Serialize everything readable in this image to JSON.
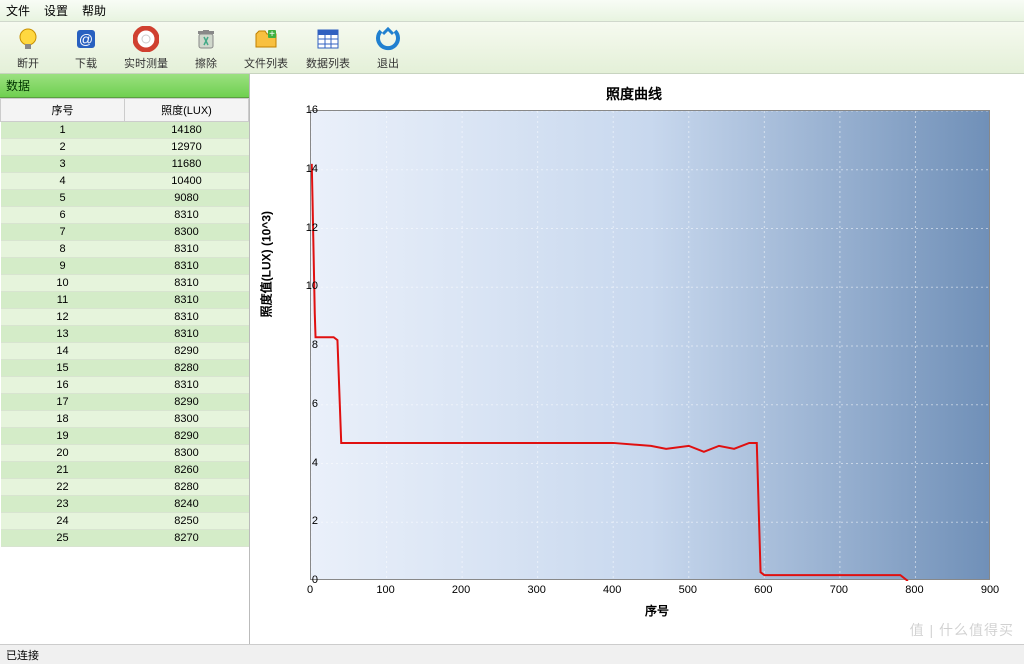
{
  "menubar": {
    "file": "文件",
    "settings": "设置",
    "help": "帮助"
  },
  "toolbar": {
    "disconnect": "断开",
    "download": "下载",
    "realtime": "实时测量",
    "erase": "擦除",
    "filelist": "文件列表",
    "datalist": "数据列表",
    "exit": "退出"
  },
  "panel": {
    "title": "数据"
  },
  "table": {
    "headers": {
      "seq": "序号",
      "lux": "照度(LUX)"
    },
    "rows": [
      {
        "seq": 1,
        "lux": 14180
      },
      {
        "seq": 2,
        "lux": 12970
      },
      {
        "seq": 3,
        "lux": 11680
      },
      {
        "seq": 4,
        "lux": 10400
      },
      {
        "seq": 5,
        "lux": 9080
      },
      {
        "seq": 6,
        "lux": 8310
      },
      {
        "seq": 7,
        "lux": 8300
      },
      {
        "seq": 8,
        "lux": 8310
      },
      {
        "seq": 9,
        "lux": 8310
      },
      {
        "seq": 10,
        "lux": 8310
      },
      {
        "seq": 11,
        "lux": 8310
      },
      {
        "seq": 12,
        "lux": 8310
      },
      {
        "seq": 13,
        "lux": 8310
      },
      {
        "seq": 14,
        "lux": 8290
      },
      {
        "seq": 15,
        "lux": 8280
      },
      {
        "seq": 16,
        "lux": 8310
      },
      {
        "seq": 17,
        "lux": 8290
      },
      {
        "seq": 18,
        "lux": 8300
      },
      {
        "seq": 19,
        "lux": 8290
      },
      {
        "seq": 20,
        "lux": 8300
      },
      {
        "seq": 21,
        "lux": 8260
      },
      {
        "seq": 22,
        "lux": 8280
      },
      {
        "seq": 23,
        "lux": 8240
      },
      {
        "seq": 24,
        "lux": 8250
      },
      {
        "seq": 25,
        "lux": 8270
      }
    ]
  },
  "chart": {
    "title": "照度曲线",
    "xlabel": "序号",
    "ylabel": "照度值(LUX) (10^3)",
    "xticks": [
      0,
      100,
      200,
      300,
      400,
      500,
      600,
      700,
      800,
      900
    ],
    "yticks": [
      0,
      2,
      4,
      6,
      8,
      10,
      12,
      14,
      16
    ]
  },
  "chart_data": {
    "type": "line",
    "title": "照度曲线",
    "xlabel": "序号",
    "ylabel": "照度值(LUX) (10^3)",
    "xlim": [
      0,
      900
    ],
    "ylim": [
      0,
      16
    ],
    "series": [
      {
        "name": "照度",
        "x": [
          1,
          2,
          3,
          4,
          5,
          6,
          10,
          20,
          30,
          35,
          40,
          50,
          100,
          200,
          300,
          400,
          450,
          470,
          500,
          520,
          540,
          560,
          580,
          585,
          590,
          595,
          600,
          650,
          700,
          750,
          780,
          790
        ],
        "values": [
          14.2,
          13.0,
          11.7,
          10.4,
          9.1,
          8.3,
          8.3,
          8.3,
          8.3,
          8.2,
          4.7,
          4.7,
          4.7,
          4.7,
          4.7,
          4.7,
          4.6,
          4.5,
          4.6,
          4.4,
          4.6,
          4.5,
          4.7,
          4.7,
          4.7,
          0.3,
          0.2,
          0.2,
          0.2,
          0.2,
          0.2,
          0.0
        ]
      }
    ]
  },
  "status": {
    "connected": "已连接"
  },
  "watermark": "值 | 什么值得买"
}
